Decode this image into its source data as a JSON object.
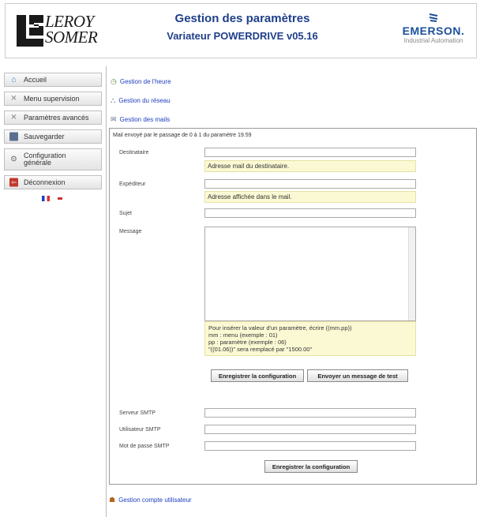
{
  "header": {
    "leroy_lines": [
      "LEROY",
      "SOMER"
    ],
    "title": "Gestion des paramètres",
    "subtitle": "Variateur POWERDRIVE v05.16",
    "brand": "EMERSON.",
    "brand_sub": "Industrial Automation"
  },
  "sidebar": {
    "items": [
      {
        "label": "Accueil",
        "icon": "home-icon"
      },
      {
        "label": "Menu supervision",
        "icon": "wrench-icon"
      },
      {
        "label": "Paramètres avancés",
        "icon": "wrench-icon"
      },
      {
        "label": "Sauvegarder",
        "icon": "save-icon"
      },
      {
        "label": "Configuration générale",
        "icon": "gear-icon"
      },
      {
        "label": "Déconnexion",
        "icon": "logout-icon"
      }
    ],
    "languages": [
      "fr",
      "en"
    ]
  },
  "links": {
    "time": "Gestion de l'heure",
    "network": "Gestion du réseau",
    "mails": "Gestion des mails",
    "users": "Gestion compte utilisateur"
  },
  "mail_panel": {
    "title": "Mail envoyé par le passage de 0 à 1 du paramètre 19.59",
    "recipient_label": "Destinataire",
    "recipient_value": "",
    "recipient_hint": "Adresse mail du destinataire.",
    "sender_label": "Expéditeur",
    "sender_value": "",
    "sender_hint": "Adresse affichée dans le mail.",
    "subject_label": "Sujet",
    "subject_value": "",
    "message_label": "Message",
    "message_value": "",
    "message_hint_lines": [
      "Pour insérer la valeur d'un paramètre, écrire ((mm.pp))",
      "mm : menu (exemple : 01)",
      "pp : paramètre (exemple : 06)",
      "\"((01.06))\" sera remplacé par \"1500.00\""
    ],
    "save_button": "Enregistrer la configuration",
    "test_button": "Envoyer un message de test",
    "smtp_server_label": "Serveur SMTP",
    "smtp_server_value": "",
    "smtp_user_label": "Utilisateur SMTP",
    "smtp_user_value": "",
    "smtp_password_label": "Mot de passe SMTP",
    "smtp_password_value": "",
    "save_button_2": "Enregistrer la configuration"
  },
  "colors": {
    "title": "#1f3f8a",
    "link": "#1f3fbf",
    "hint_bg": "#fbf9d4",
    "brand": "#1b4f9c"
  }
}
